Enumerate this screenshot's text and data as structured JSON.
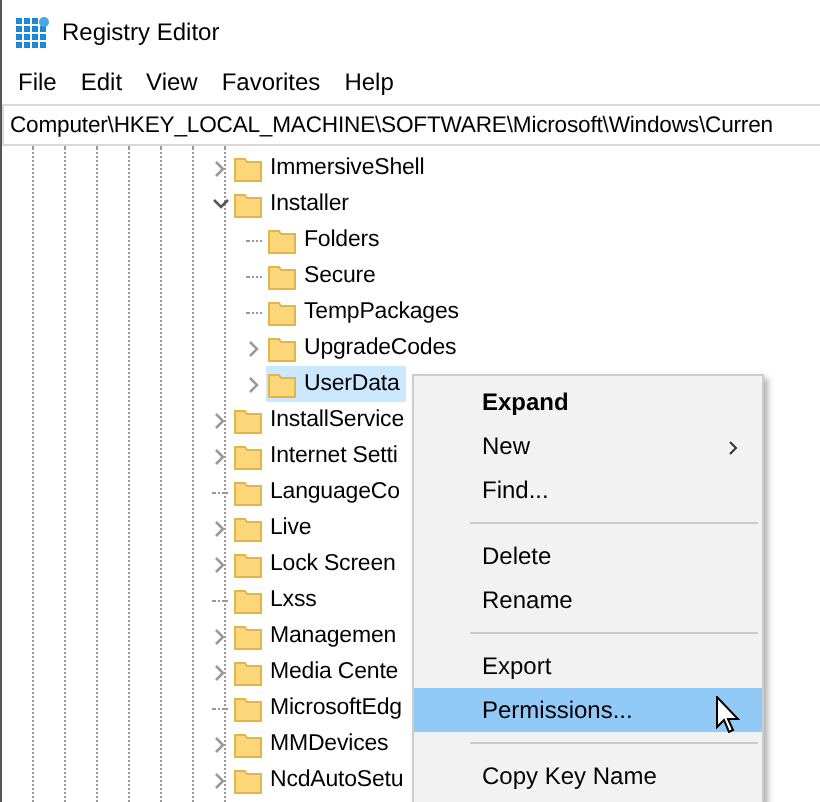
{
  "window": {
    "title": "Registry Editor"
  },
  "menu_bar": [
    "File",
    "Edit",
    "View",
    "Favorites",
    "Help"
  ],
  "address_bar": {
    "value": "Computer\\HKEY_LOCAL_MACHINE\\SOFTWARE\\Microsoft\\Windows\\Curren"
  },
  "tree": [
    {
      "label": "ImmersiveShell",
      "expandable": true,
      "expanded": false,
      "selected": false
    },
    {
      "label": "Installer",
      "expandable": true,
      "expanded": true,
      "selected": false,
      "children": [
        {
          "label": "Folders",
          "expandable": false,
          "selected": false
        },
        {
          "label": "Secure",
          "expandable": false,
          "selected": false
        },
        {
          "label": "TempPackages",
          "expandable": false,
          "selected": false
        },
        {
          "label": "UpgradeCodes",
          "expandable": true,
          "expanded": false,
          "selected": false
        },
        {
          "label": "UserData",
          "expandable": true,
          "expanded": false,
          "selected": true
        }
      ]
    },
    {
      "label": "InstallService",
      "expandable": true,
      "expanded": false,
      "selected": false
    },
    {
      "label": "Internet Setti",
      "expandable": true,
      "expanded": false,
      "selected": false
    },
    {
      "label": "LanguageCo",
      "expandable": false,
      "selected": false
    },
    {
      "label": "Live",
      "expandable": true,
      "expanded": false,
      "selected": false
    },
    {
      "label": "Lock Screen",
      "expandable": true,
      "expanded": false,
      "selected": false
    },
    {
      "label": "Lxss",
      "expandable": false,
      "selected": false
    },
    {
      "label": "Managemen",
      "expandable": true,
      "expanded": false,
      "selected": false
    },
    {
      "label": "Media Cente",
      "expandable": true,
      "expanded": false,
      "selected": false
    },
    {
      "label": "MicrosoftEdg",
      "expandable": false,
      "selected": false
    },
    {
      "label": "MMDevices",
      "expandable": true,
      "expanded": false,
      "selected": false
    },
    {
      "label": "NcdAutoSetu",
      "expandable": true,
      "expanded": false,
      "selected": false
    }
  ],
  "context_menu": [
    {
      "kind": "item",
      "label": "Expand",
      "default": true,
      "submenu": false,
      "selected": false
    },
    {
      "kind": "item",
      "label": "New",
      "default": false,
      "submenu": true,
      "selected": false
    },
    {
      "kind": "item",
      "label": "Find...",
      "default": false,
      "submenu": false,
      "selected": false
    },
    {
      "kind": "separator"
    },
    {
      "kind": "item",
      "label": "Delete",
      "default": false,
      "submenu": false,
      "selected": false
    },
    {
      "kind": "item",
      "label": "Rename",
      "default": false,
      "submenu": false,
      "selected": false
    },
    {
      "kind": "separator"
    },
    {
      "kind": "item",
      "label": "Export",
      "default": false,
      "submenu": false,
      "selected": false
    },
    {
      "kind": "item",
      "label": "Permissions...",
      "default": false,
      "submenu": false,
      "selected": true
    },
    {
      "kind": "separator"
    },
    {
      "kind": "item",
      "label": "Copy Key Name",
      "default": false,
      "submenu": false,
      "selected": false
    }
  ]
}
